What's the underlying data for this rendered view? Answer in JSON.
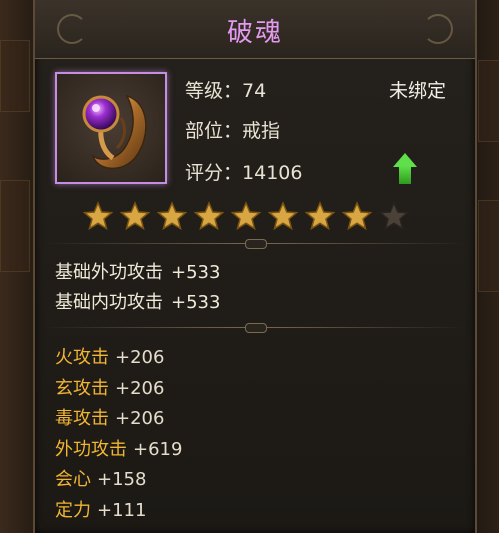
{
  "item": {
    "name": "破魂",
    "level_label": "等级：",
    "level_value": "74",
    "slot_label": "部位：",
    "slot_value": "戒指",
    "score_label": "评分：",
    "score_value": "14106",
    "bind_state": "未绑定",
    "upgrade_icon": "green-up-arrow-icon",
    "stars": {
      "filled": 8,
      "total": 9
    },
    "colors": {
      "title": "#e39af0",
      "frame": "#c48fe0",
      "star": "#d8a642",
      "bonus_label": "#f2b534",
      "arrow": "#5fe04a"
    }
  },
  "base_stats": [
    {
      "label": "基础外功攻击",
      "value": "+533"
    },
    {
      "label": "基础内功攻击",
      "value": "+533"
    }
  ],
  "bonus_stats": [
    {
      "label": "火攻击",
      "value": "+206"
    },
    {
      "label": "玄攻击",
      "value": "+206"
    },
    {
      "label": "毒攻击",
      "value": "+206"
    },
    {
      "label": "外功攻击",
      "value": "+619"
    },
    {
      "label": "会心",
      "value": "+158"
    },
    {
      "label": "定力",
      "value": "+111"
    }
  ]
}
